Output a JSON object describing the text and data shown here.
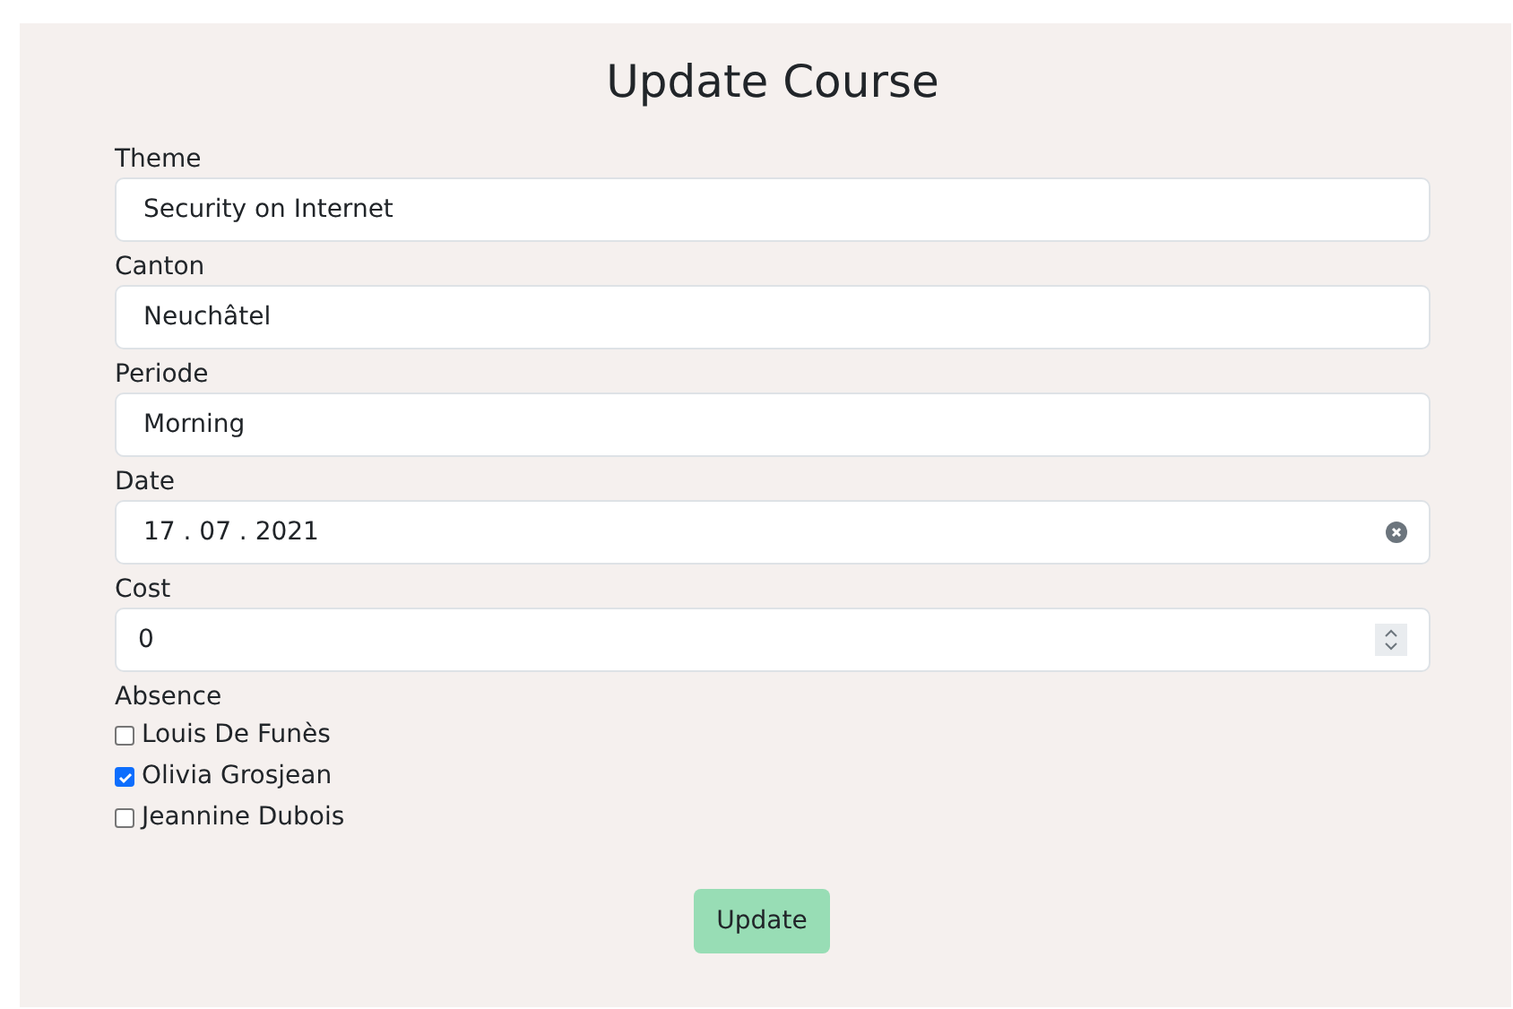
{
  "title": "Update Course",
  "fields": [
    {
      "label": "Theme",
      "kind": "text",
      "value": "Security on Internet"
    },
    {
      "label": "Canton",
      "kind": "text",
      "value": "Neuchâtel"
    },
    {
      "label": "Periode",
      "kind": "text",
      "value": "Morning"
    },
    {
      "label": "Date",
      "kind": "date",
      "value": "17 . 07 . 2021"
    },
    {
      "label": "Cost",
      "kind": "number",
      "value": "0"
    }
  ],
  "absence": {
    "label": "Absence",
    "people": [
      {
        "name": "Louis De Funès",
        "checked": false
      },
      {
        "name": "Olivia Grosjean",
        "checked": true
      },
      {
        "name": "Jeannine Dubois",
        "checked": false
      }
    ]
  },
  "button": "Update"
}
